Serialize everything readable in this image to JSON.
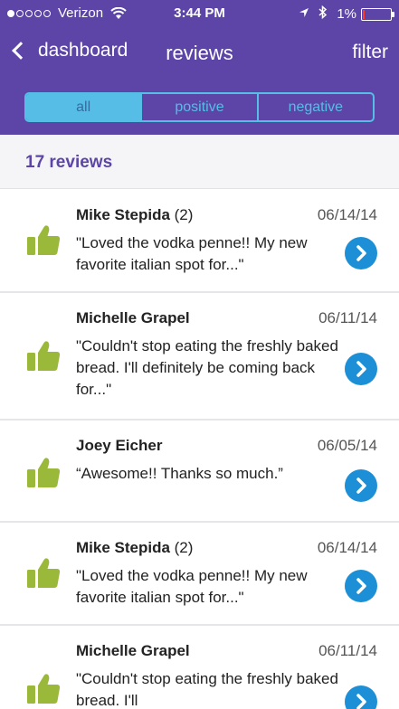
{
  "status_bar": {
    "carrier": "Verizon",
    "time": "3:44 PM",
    "battery": "1%",
    "battery_level": 0.01
  },
  "nav": {
    "back_label": "dashboard",
    "title": "reviews",
    "filter_label": "filter"
  },
  "segments": [
    {
      "label": "all",
      "active": true
    },
    {
      "label": "positive",
      "active": false
    },
    {
      "label": "negative",
      "active": false
    }
  ],
  "count_label": "17 reviews",
  "reviews": [
    {
      "name": "Mike Stepida",
      "count": " (2)",
      "date": "06/14/14",
      "text": "\"Loved the vodka penne!! My new favorite italian spot for...\"",
      "sentiment": "positive"
    },
    {
      "name": "Michelle Grapel",
      "count": "",
      "date": "06/11/14",
      "text": "\"Couldn't stop eating the freshly baked bread. I'll definitely be coming back for...\"",
      "sentiment": "positive"
    },
    {
      "name": "Joey Eicher",
      "count": "",
      "date": "06/05/14",
      "text": "“Awesome!! Thanks so much.”",
      "sentiment": "positive"
    },
    {
      "name": "Mike Stepida",
      "count": " (2)",
      "date": "06/14/14",
      "text": "\"Loved the vodka penne!! My new favorite italian spot for...\"",
      "sentiment": "positive"
    },
    {
      "name": "Michelle Grapel",
      "count": "",
      "date": "06/11/14",
      "text": "\"Couldn't stop eating the freshly baked bread. I'll",
      "sentiment": "positive"
    }
  ],
  "colors": {
    "header": "#5c45a6",
    "segment_accent": "#56bde6",
    "thumb": "#9ab83a",
    "go_button": "#1d8fd6"
  },
  "icons": {
    "back": "chevron-left-icon",
    "thumb": "thumbs-up-icon",
    "go": "chevron-right-icon"
  }
}
